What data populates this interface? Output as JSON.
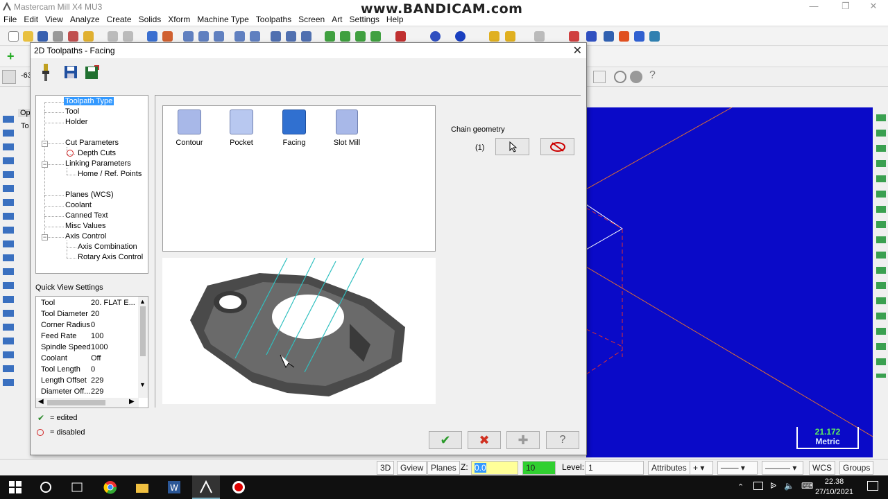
{
  "app": {
    "title": "Mastercam Mill X4 MU3",
    "watermark": "www.BANDICAM.com"
  },
  "menu": [
    "File",
    "Edit",
    "View",
    "Analyze",
    "Create",
    "Solids",
    "Xform",
    "Machine Type",
    "Toolpaths",
    "Screen",
    "Art",
    "Settings",
    "Help"
  ],
  "toolbar2": {
    "coord_prefix": "-63",
    "tab_prefix_1": "Op",
    "tab_prefix_2": "To"
  },
  "dialog": {
    "title": "2D Toolpaths - Facing",
    "tree": [
      {
        "label": "Toolpath Type",
        "level": 0,
        "selected": true
      },
      {
        "label": "Tool",
        "level": 0
      },
      {
        "label": "Holder",
        "level": 0
      },
      {
        "label": "Cut Parameters",
        "level": 0
      },
      {
        "label": "Depth Cuts",
        "level": 1,
        "disabled": true
      },
      {
        "label": "Linking Parameters",
        "level": 0
      },
      {
        "label": "Home / Ref. Points",
        "level": 1
      },
      {
        "label": "Planes (WCS)",
        "level": 0
      },
      {
        "label": "Coolant",
        "level": 0
      },
      {
        "label": "Canned Text",
        "level": 0
      },
      {
        "label": "Misc Values",
        "level": 0
      },
      {
        "label": "Axis Control",
        "level": 0
      },
      {
        "label": "Axis Combination",
        "level": 1
      },
      {
        "label": "Rotary Axis Control",
        "level": 1
      }
    ],
    "quick_view_label": "Quick View Settings",
    "quick_view": [
      {
        "k": "Tool",
        "v": "20. FLAT E..."
      },
      {
        "k": "Tool Diameter",
        "v": "20"
      },
      {
        "k": "Corner Radius",
        "v": "0"
      },
      {
        "k": "Feed Rate",
        "v": "100"
      },
      {
        "k": "Spindle Speed",
        "v": "1000"
      },
      {
        "k": "Coolant",
        "v": "Off"
      },
      {
        "k": "Tool Length",
        "v": "0"
      },
      {
        "k": "Length Offset",
        "v": "229"
      },
      {
        "k": "Diameter Off...",
        "v": "229"
      }
    ],
    "legend_edited": "= edited",
    "legend_disabled": "= disabled",
    "toolpath_types": [
      {
        "label": "Contour",
        "selected": false
      },
      {
        "label": "Pocket",
        "selected": false
      },
      {
        "label": "Facing",
        "selected": true
      },
      {
        "label": "Slot Mill",
        "selected": false
      }
    ],
    "chain": {
      "label": "Chain geometry",
      "count": "(1)"
    }
  },
  "viewport": {
    "scale_value": "21.172",
    "scale_unit": "Metric"
  },
  "statusbar": {
    "btn_3d": "3D",
    "btn_gview": "Gview",
    "btn_planes": "Planes",
    "z_label": "Z:",
    "z_value": "0.0",
    "color_value": "10",
    "level_label": "Level:",
    "level_value": "1",
    "btn_attributes": "Attributes",
    "btn_wcs": "WCS",
    "btn_groups": "Groups"
  },
  "taskbar": {
    "time": "22.38",
    "date": "27/10/2021"
  },
  "colors": {
    "viewport_bg": "#0a0ac8",
    "selection": "#3399ff",
    "accent_green": "#2fbf2f"
  }
}
